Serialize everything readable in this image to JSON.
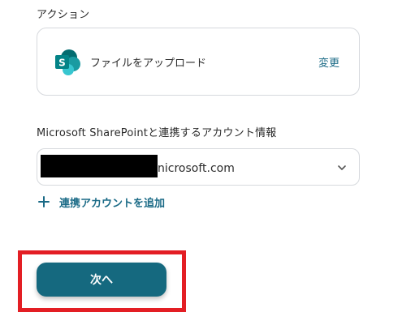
{
  "action": {
    "section_label": "アクション",
    "name": "ファイルをアップロード",
    "change_label": "変更",
    "icon": "sharepoint-logo-icon"
  },
  "account": {
    "section_label": "Microsoft SharePointと連携するアカウント情報",
    "value_visible_suffix": "nicrosoft.com",
    "add_label": "連携アカウントを追加"
  },
  "footer": {
    "next_label": "次へ"
  },
  "colors": {
    "accent": "#15697f",
    "link": "#1a6a86",
    "highlight": "#e31e24",
    "sharepoint_dark": "#036c70",
    "sharepoint_mid": "#1a9ba1",
    "sharepoint_light": "#37c6d0"
  }
}
